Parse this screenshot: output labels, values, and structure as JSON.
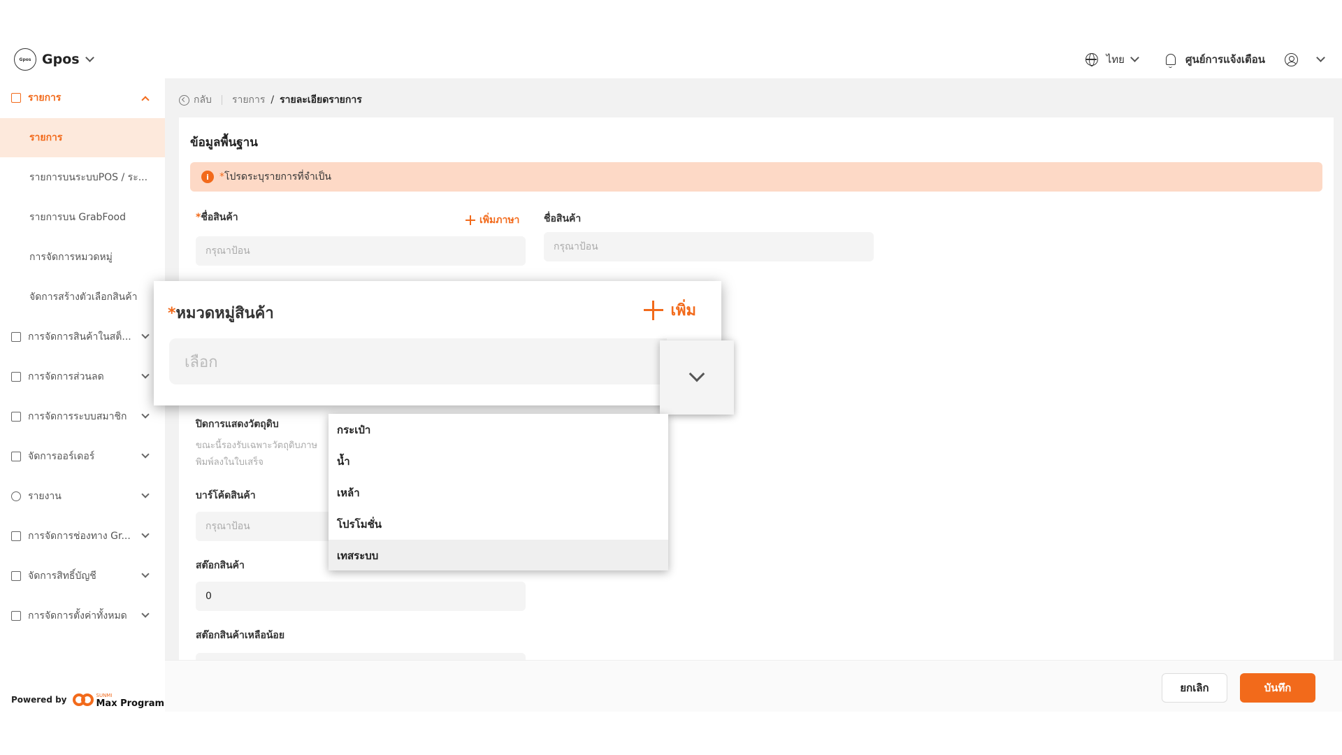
{
  "header": {
    "logo_text": "Gpos",
    "brand": "Gpos",
    "language": "ไทย",
    "notifications_label": "ศูนย์การแจ้งเตือน"
  },
  "sidebar": {
    "items": [
      {
        "label": "รายการ"
      },
      {
        "label": "รายการ"
      },
      {
        "label": "รายการบนระบบPOS / ระ..."
      },
      {
        "label": "รายการบน GrabFood"
      },
      {
        "label": "การจัดการหมวดหมู่"
      },
      {
        "label": "จัดการสร้างตัวเลือกสินค้า"
      },
      {
        "label": "การจัดการสินค้าในสต็..."
      },
      {
        "label": "การจัดการส่วนลด"
      },
      {
        "label": "การจัดการระบบสมาชิก"
      },
      {
        "label": "จัดการออร์เดอร์"
      },
      {
        "label": "รายงาน"
      },
      {
        "label": "การจัดการช่องทาง Gr..."
      },
      {
        "label": "จัดการสิทธิ์บัญชี"
      },
      {
        "label": "การจัดการตั้งค่าทั้งหมด"
      }
    ],
    "powered_by": "Powered by",
    "powered_brand_small": "SUNMI",
    "powered_brand": "Max Program"
  },
  "breadcrumb": {
    "back": "กลับ",
    "parent": "รายการ",
    "separator": "/",
    "current": "รายละเอียดรายการ"
  },
  "form": {
    "section_title": "ข้อมูลพื้นฐาน",
    "alert": "โปรดระบุรายการที่จำเป็น",
    "required_mark": "*",
    "product_name_label": "ชื่อสินค้า",
    "add_language": "เพิ่มภาษา",
    "product_name_placeholder": "กรุณาป้อน",
    "product_name_alt_label": "ชื่อสินค้า",
    "product_name_alt_placeholder": "กรุณาป้อน",
    "hide_ingredients_label": "ปิดการแสดงวัตถุดิบ",
    "hide_ingredients_help_1": "ขณะนี้รองรับเฉพาะวัตถุดิบภาษ",
    "hide_ingredients_help_2": "พิมพ์ลงในใบเสร็จ",
    "barcode_label": "บาร์โค้ดสินค้า",
    "barcode_placeholder": "กรุณาป้อน",
    "stock_label": "สต๊อกสินค้า",
    "stock_value": "0",
    "low_stock_label": "สต๊อกสินค้าเหลือน้อย"
  },
  "zoom": {
    "category_label": "หมวดหมู่สินค้า",
    "add_label": "เพิ่ม",
    "select_placeholder": "เลือก"
  },
  "dropdown": {
    "options": [
      "กระเป๋า",
      "น้ำ",
      "เหล้า",
      "โปรโมชั่น",
      "เทสระบบ"
    ]
  },
  "footer": {
    "cancel": "ยกเลิก",
    "save": "บันทึก"
  },
  "colors": {
    "accent": "#f26a1b",
    "alert_bg": "#fdd9c6",
    "active_bg": "#fde9dc"
  },
  "icons": {
    "logo": "gpos-logo-icon",
    "language": "globe-icon",
    "notifications": "bell-icon",
    "account": "user-icon",
    "back": "back-icon",
    "alert": "info-icon",
    "add": "plus-icon",
    "expand": "chevron-down-icon"
  }
}
